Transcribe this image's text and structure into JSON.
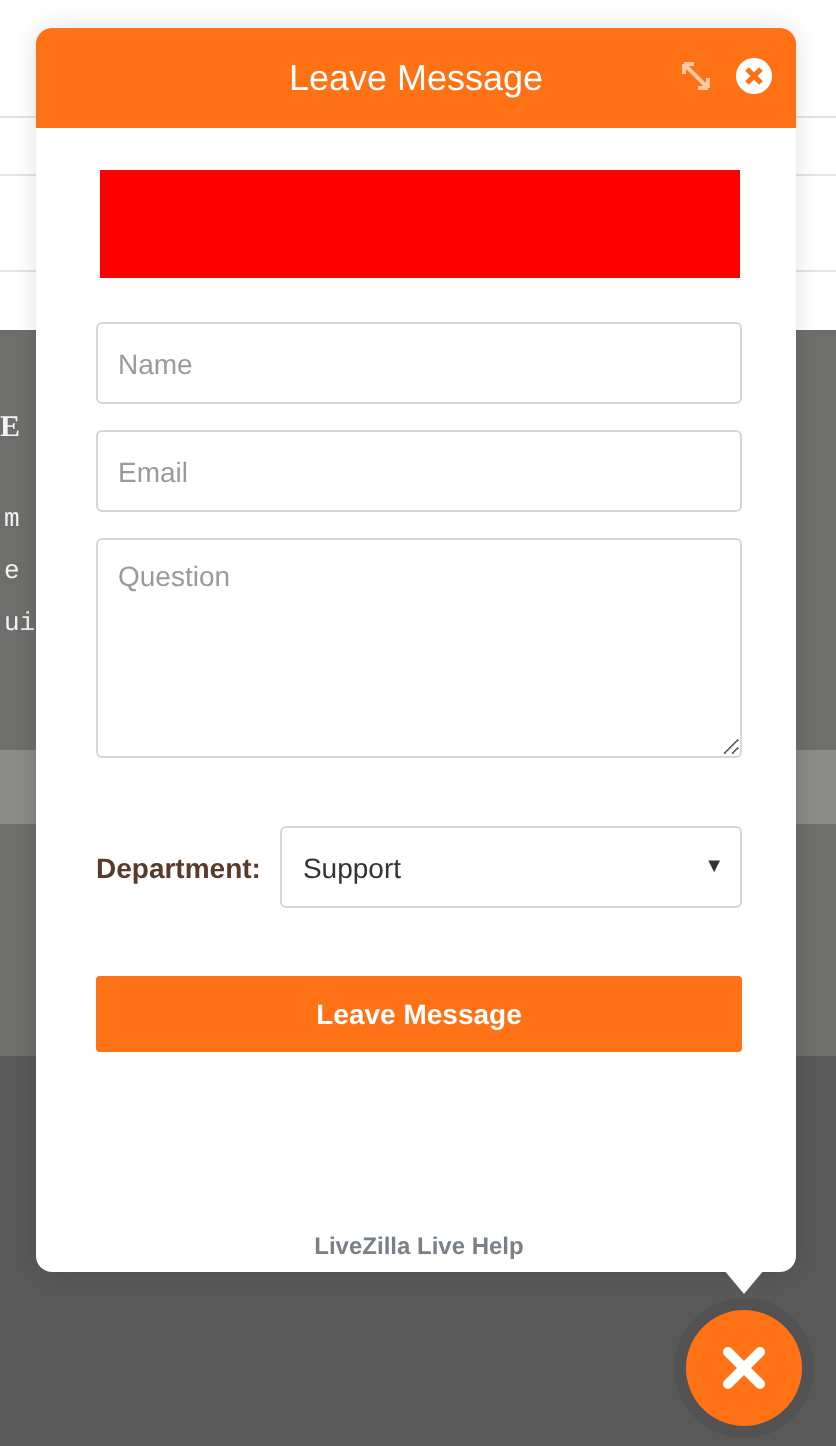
{
  "background_page": {
    "heading_fragment": "E",
    "text_fragments": [
      "m",
      "e",
      "ui"
    ]
  },
  "dialog": {
    "title": "Leave Message",
    "fields": [
      {
        "kind": "input",
        "placeholder": "Name"
      },
      {
        "kind": "input",
        "placeholder": "Email"
      },
      {
        "kind": "textarea",
        "placeholder": "Question"
      }
    ],
    "department": {
      "label": "Department:",
      "value": "Support",
      "caret": "▼"
    },
    "submit": "Leave Message",
    "footer": "LiveZilla Live Help"
  }
}
